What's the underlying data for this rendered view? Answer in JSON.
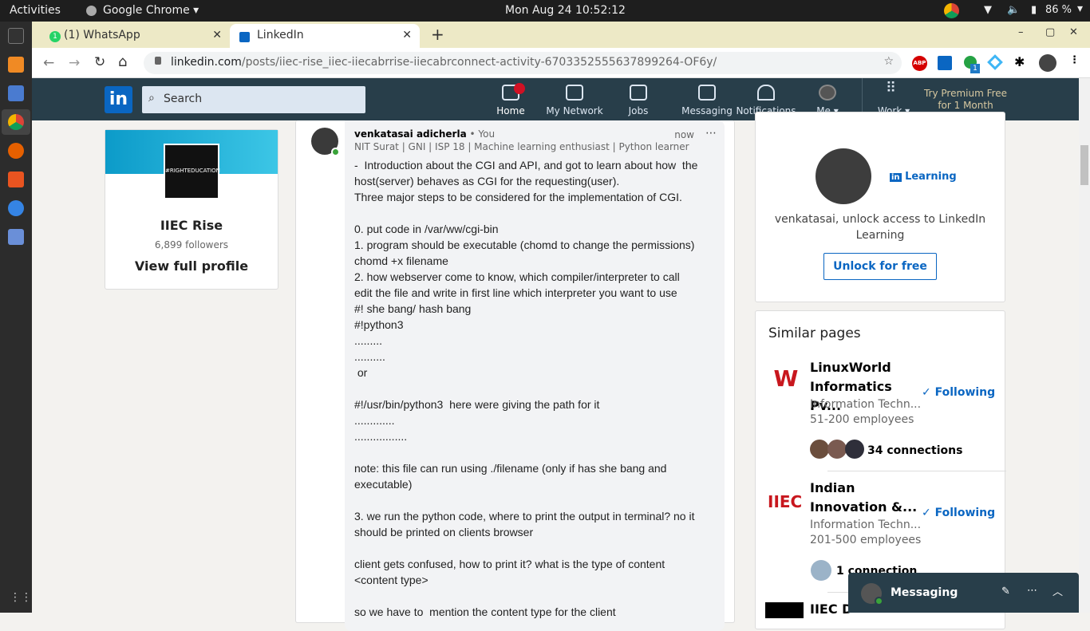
{
  "os": {
    "activities": "Activities",
    "app": "Google Chrome",
    "clock": "Mon Aug 24  10:52:12",
    "battery": "86 %"
  },
  "browser": {
    "tabs": [
      {
        "label": "(1) WhatsApp",
        "badge": "1"
      },
      {
        "label": "LinkedIn"
      }
    ],
    "url_host": "linkedin.com",
    "url_path": "/posts/iiec-rise_iiec-iiecabrrise-iiecabrconnect-activity-6703352555637899264-OF6y/",
    "ext_badge": "1",
    "abp": "ABP"
  },
  "header": {
    "logo": "in",
    "search_placeholder": "Search",
    "nav": [
      "Home",
      "My Network",
      "Jobs",
      "Messaging",
      "Notifications",
      "Me",
      "Work"
    ],
    "premium": "Try Premium Free for 1 Month"
  },
  "left_card": {
    "name": "IIEC Rise",
    "followers": "6,899 followers",
    "view": "View full profile",
    "banner_text": "#RIGHTEDUCATION"
  },
  "post": {
    "author": "venkatasai adicherla",
    "you": "• You",
    "time": "now",
    "headline": "NIT Surat | GNI | ISP 18 | Machine learning enthusiast | Python learner",
    "body": "-  Introduction about the CGI and API, and got to learn about how  the host(server) behaves as CGI for the requesting(user).\nThree major steps to be considered for the implementation of CGI.\n\n0. put code in /var/ww/cgi-bin\n1. program should be executable (chomd to change the permissions)\nchomd +x filename\n2. how webserver come to know, which compiler/interpreter to call\nedit the file and write in first line which interpreter you want to use\n#! she bang/ hash bang\n#!python3\n.........\n..........\n or\n\n#!/usr/bin/python3  here were giving the path for it\n.............\n.................\n\nnote: this file can run using ./filename (only if has she bang and executable)\n\n3. we run the python code, where to print the output in terminal? no it should be printed on clients browser\n\nclient gets confused, how to print it? what is the type of content\n<content type>\n\nso we have to  mention the content type for the client"
  },
  "learning": {
    "brand": "Learning",
    "text": "venkatasai, unlock access to LinkedIn Learning",
    "button": "Unlock for free"
  },
  "similar": {
    "title": "Similar pages",
    "items": [
      {
        "name": "LinuxWorld Informatics Pv...",
        "industry": "Information Techn...",
        "size": "51-200 employees",
        "connections": "34 connections",
        "follow": "Following"
      },
      {
        "name": "Indian Innovation &...",
        "industry": "Information Techn...",
        "size": "201-500 employees",
        "connections": "1 connection",
        "follow": "Following"
      },
      {
        "name": "IIEC D"
      }
    ]
  },
  "messaging": {
    "label": "Messaging"
  }
}
